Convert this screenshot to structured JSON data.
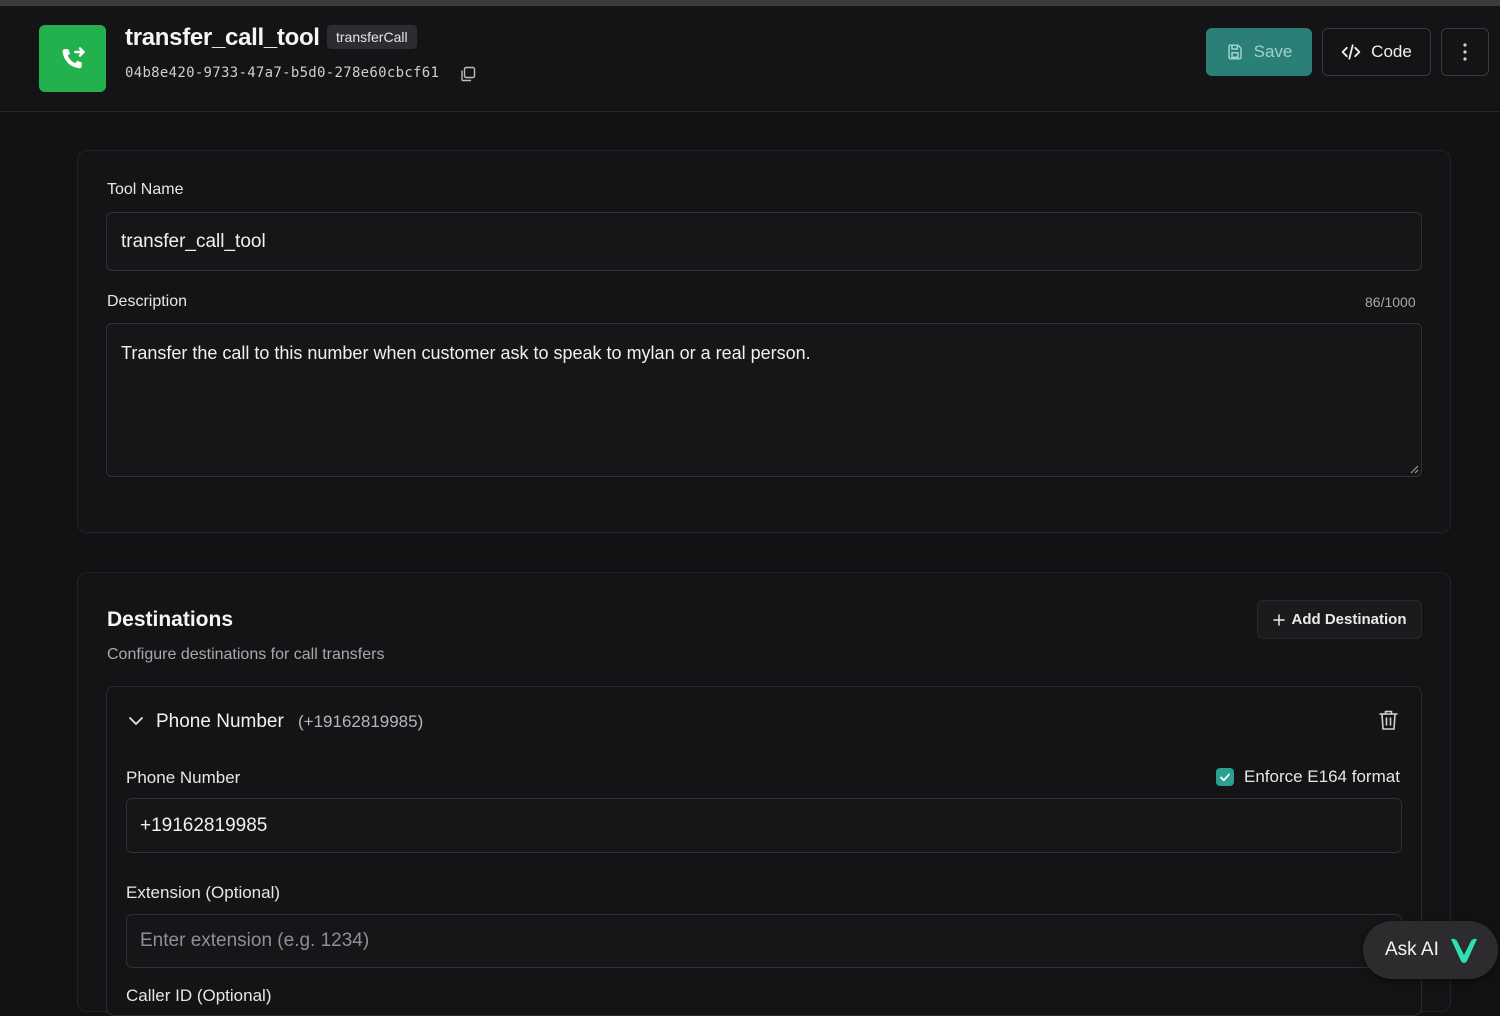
{
  "header": {
    "tool_title": "transfer_call_tool",
    "type_badge": "transferCall",
    "tool_id": "04b8e420-9733-47a7-b5d0-278e60cbcf61",
    "save_label": "Save",
    "code_label": "Code"
  },
  "form": {
    "tool_name_label": "Tool Name",
    "tool_name_value": "transfer_call_tool",
    "description_label": "Description",
    "description_counter": "86/1000",
    "description_value": "Transfer the call to this number when customer ask to speak to mylan or a real person."
  },
  "destinations": {
    "title": "Destinations",
    "subtitle": "Configure destinations for call transfers",
    "add_label": "Add Destination",
    "items": [
      {
        "title": "Phone Number",
        "number_display": "(+19162819985)",
        "phone_label": "Phone Number",
        "enforce_label": "Enforce E164 format",
        "enforce_checked": true,
        "phone_value": "+19162819985",
        "extension_label": "Extension (Optional)",
        "extension_placeholder": "Enter extension (e.g. 1234)",
        "caller_id_label": "Caller ID (Optional)"
      }
    ]
  },
  "assistant": {
    "ask_ai_label": "Ask AI"
  },
  "colors": {
    "app_icon_bg": "#22b14c",
    "save_button_bg": "#2a7f76",
    "checkbox_bg": "#2c9f90",
    "ask_ai_logo": "#2fe0b0"
  },
  "icons": {
    "app_icon": "phone-transfer-icon",
    "copy": "copy-icon",
    "save": "save-icon",
    "code": "code-icon",
    "more": "more-vertical-icon",
    "add": "plus-icon",
    "chevron": "chevron-down-icon",
    "trash": "trash-icon",
    "check": "check-icon",
    "ask_ai_logo": "v-logo-icon"
  }
}
